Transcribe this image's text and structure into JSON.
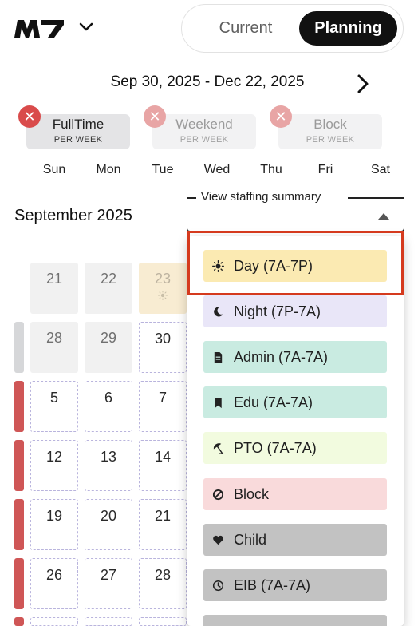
{
  "header": {
    "logo_text": "M7",
    "view_toggle": {
      "options": [
        "Current",
        "Planning"
      ],
      "selected": "Planning"
    }
  },
  "date_range": "Sep 30, 2025 - Dec 22, 2025",
  "shift_filters": [
    {
      "name": "FullTime",
      "sub": "PER WEEK",
      "active": true
    },
    {
      "name": "Weekend",
      "sub": "PER WEEK",
      "active": false
    },
    {
      "name": "Block",
      "sub": "PER WEEK",
      "active": false
    }
  ],
  "weekdays": [
    "Sun",
    "Mon",
    "Tue",
    "Wed",
    "Thu",
    "Fri",
    "Sat"
  ],
  "month_title": "September 2025",
  "staffing_select": {
    "label": "View staffing summary",
    "value": ""
  },
  "calendar_days": [
    [
      "21",
      "22",
      "23"
    ],
    [
      "28",
      "29",
      "30"
    ],
    [
      "5",
      "6",
      "7"
    ],
    [
      "12",
      "13",
      "14"
    ],
    [
      "19",
      "20",
      "21"
    ],
    [
      "26",
      "27",
      "28"
    ]
  ],
  "menu_items": [
    {
      "label": "Day (7A-7P)",
      "icon": "sun-icon",
      "color": "#fbeab2"
    },
    {
      "label": "Night (7P-7A)",
      "icon": "moon-icon",
      "color": "#e9e6f8"
    },
    {
      "label": "Admin (7A-7A)",
      "icon": "document-icon",
      "color": "#c9ebe1"
    },
    {
      "label": "Edu (7A-7A)",
      "icon": "bookmark-icon",
      "color": "#c9ebe1"
    },
    {
      "label": "PTO (7A-7A)",
      "icon": "beach-umbrella-icon",
      "color": "#f2fbdf"
    },
    {
      "label": "Block",
      "icon": "block-icon",
      "color": "#f9dadb"
    },
    {
      "label": "Child",
      "icon": "heart-icon",
      "color": "#c2c2c2"
    },
    {
      "label": "EIB (7A-7A)",
      "icon": "clock-icon",
      "color": "#c2c2c2"
    }
  ],
  "colors": {
    "accent_dark": "#111111",
    "remove_red": "#d94b4b",
    "side_bar_red": "#cf5656",
    "highlight_border": "#d53a1e"
  }
}
